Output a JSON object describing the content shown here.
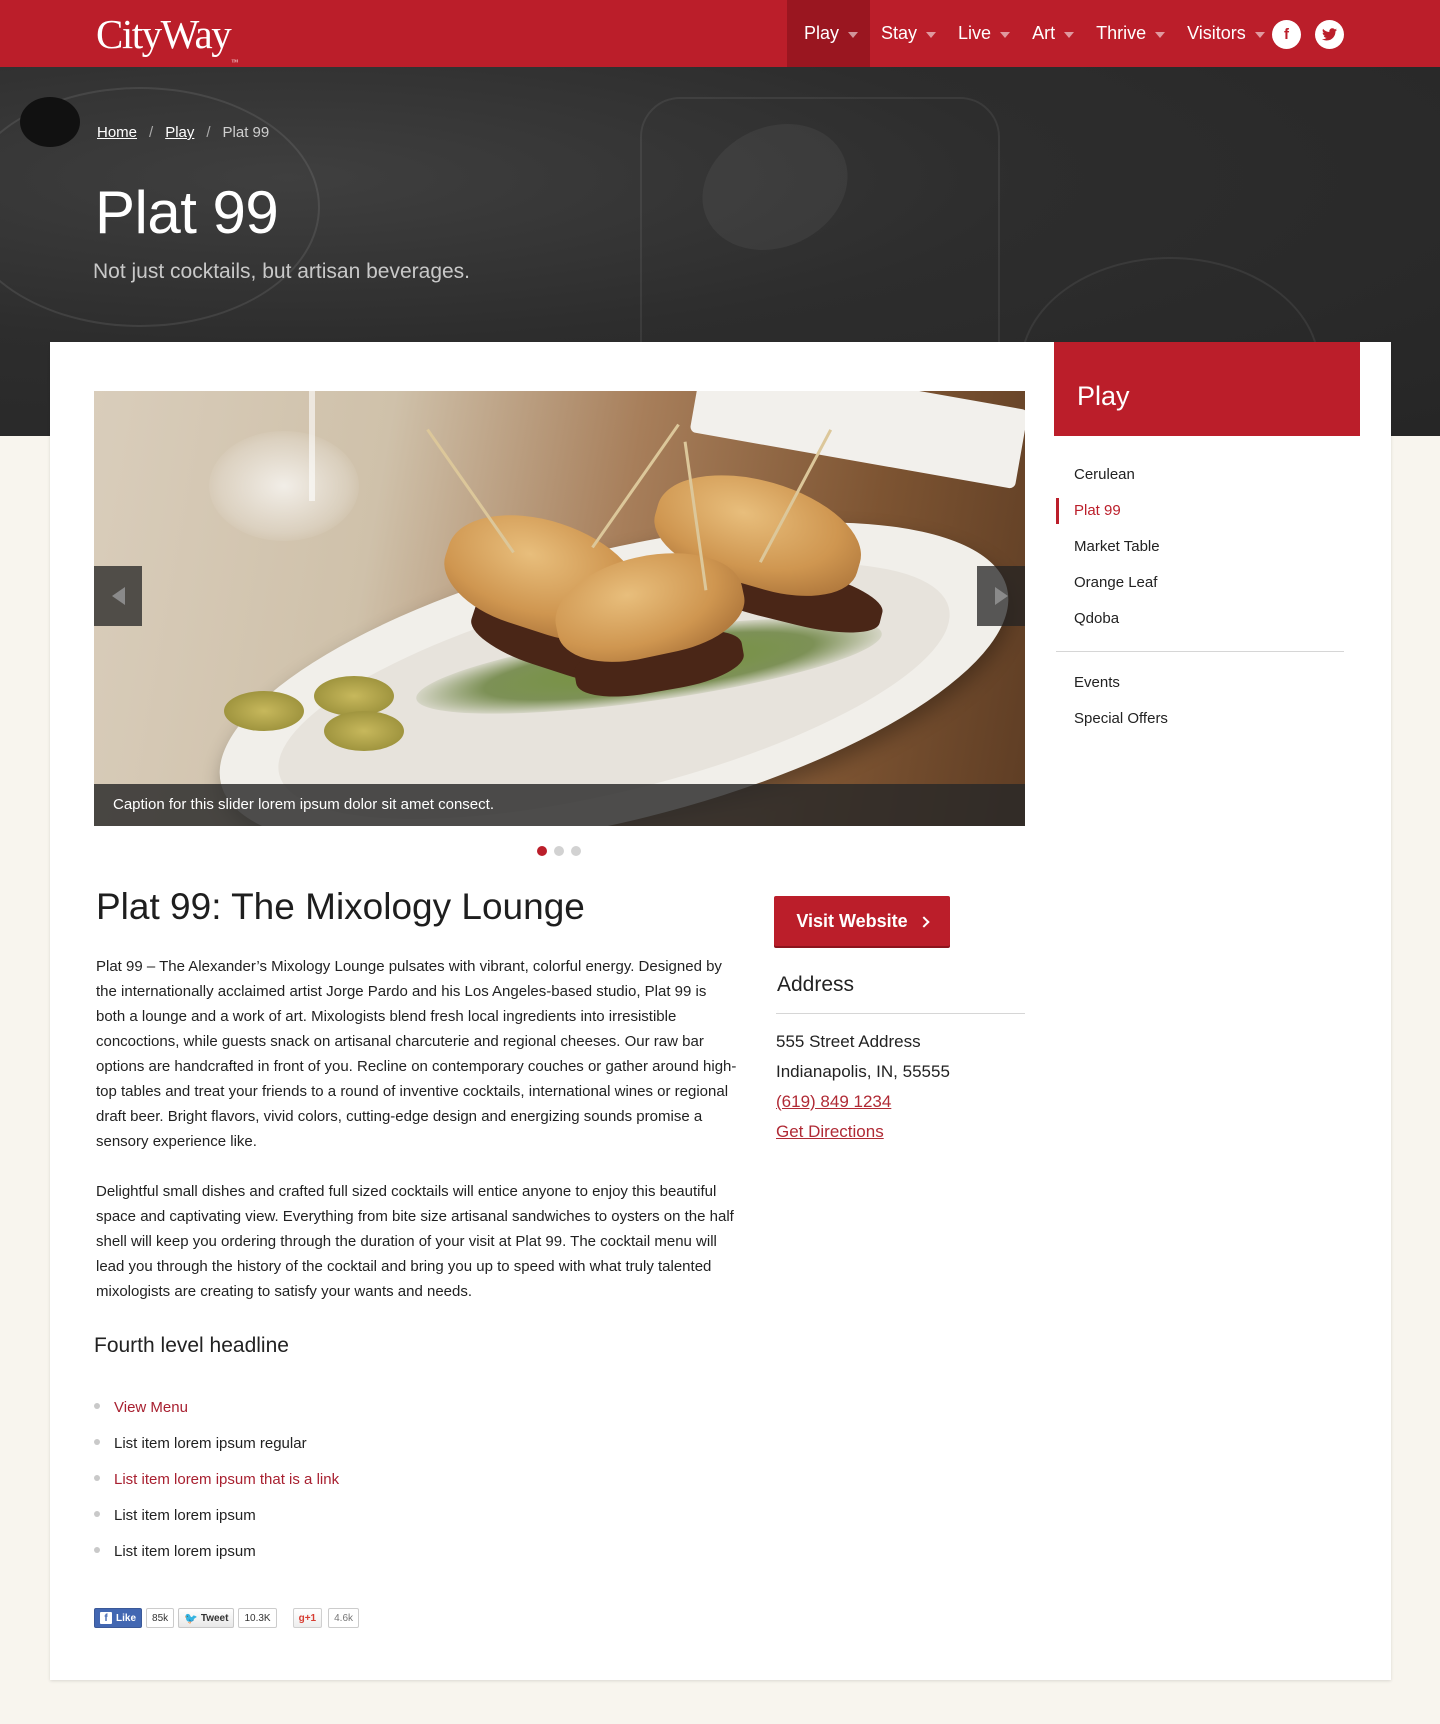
{
  "header": {
    "logo": "CityWay",
    "logo_mark": "™",
    "nav": [
      {
        "label": "Play",
        "active": true
      },
      {
        "label": "Stay",
        "active": false
      },
      {
        "label": "Live",
        "active": false
      },
      {
        "label": "Art",
        "active": false
      },
      {
        "label": "Thrive",
        "active": false
      },
      {
        "label": "Visitors",
        "active": false
      }
    ],
    "social": [
      {
        "icon": "facebook-icon",
        "glyph": "f"
      },
      {
        "icon": "twitter-icon",
        "glyph": "🐦"
      }
    ]
  },
  "hero": {
    "breadcrumb": [
      {
        "label": "Home",
        "link": true
      },
      {
        "label": "Play",
        "link": true
      },
      {
        "label": "Plat 99",
        "link": false
      }
    ],
    "separator": "/",
    "title": "Plat 99",
    "subtitle": "Not just cocktails, but artisan beverages."
  },
  "slider": {
    "caption": "Caption for this slider lorem ipsum dolor sit amet consect.",
    "slides_count": 3,
    "active_slide": 1,
    "prev_icon": "chevron-left-icon",
    "next_icon": "chevron-right-icon"
  },
  "article": {
    "title": "Plat 99: The Mixology Lounge",
    "paragraphs": [
      "Plat 99 – The Alexander’s Mixology Lounge pulsates with vibrant, colorful energy. Designed by the internationally acclaimed artist Jorge Pardo and his Los Angeles-based studio, Plat 99 is both a lounge and a work of art. Mixologists blend fresh local ingredients into irresistible concoctions, while guests snack on artisanal charcuterie and regional cheeses. Our raw bar options are handcrafted in front of you. Recline on contemporary couches or gather around high-top tables and treat your friends to a round of inventive cocktails, international wines or regional draft beer. Bright flavors, vivid colors, cutting-edge design and energizing sounds promise a sensory experience like.",
      "Delightful small dishes and crafted full sized cocktails will entice anyone to enjoy this beautiful space and captivating view. Everything from bite size artisanal sandwiches to oysters on the half shell will keep you ordering through the duration of your visit at Plat 99. The cocktail menu will lead you through the history of the cocktail and bring you up to speed with what truly talented mixologists are creating to satisfy your wants and needs."
    ],
    "subheading": "Fourth level headline",
    "list": [
      {
        "label": "View Menu",
        "link": true
      },
      {
        "label": "List item lorem ipsum regular",
        "link": false
      },
      {
        "label": "List item lorem ipsum that is a link",
        "link": true
      },
      {
        "label": "List item lorem ipsum",
        "link": false
      },
      {
        "label": "List item lorem ipsum",
        "link": false
      }
    ]
  },
  "share": {
    "facebook_label": "Like",
    "facebook_count": "85k",
    "twitter_label": "Tweet",
    "twitter_count": "10.3K",
    "gplus_label": "+1",
    "gplus_count": "4.6k"
  },
  "info": {
    "visit_button": "Visit Website",
    "address_heading": "Address",
    "address_line1": "555 Street Address",
    "address_line2": "Indianapolis, IN, 55555",
    "phone": "(619) 849 1234",
    "directions": "Get Directions"
  },
  "sidebar": {
    "heading": "Play",
    "items": [
      {
        "label": "Cerulean",
        "active": false
      },
      {
        "label": "Plat 99",
        "active": true
      },
      {
        "label": "Market Table",
        "active": false
      },
      {
        "label": "Orange Leaf",
        "active": false
      },
      {
        "label": "Qdoba",
        "active": false
      }
    ],
    "secondary_items": [
      {
        "label": "Events"
      },
      {
        "label": "Special Offers"
      }
    ]
  },
  "colors": {
    "brand_red": "#bb1e2a",
    "link_red": "#a82030",
    "hero_dark": "#2d2d2d",
    "page_bg": "#f8f5ee"
  }
}
